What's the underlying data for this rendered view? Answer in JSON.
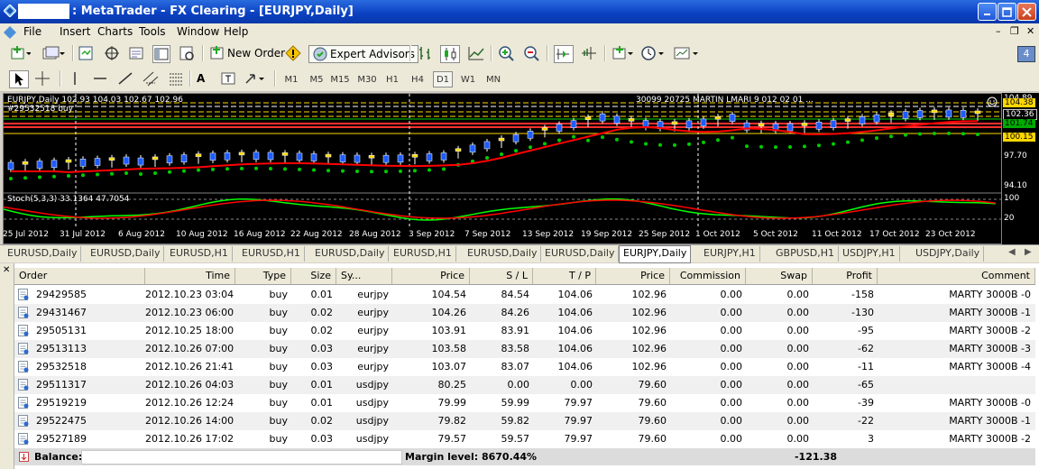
{
  "window": {
    "title": ": MetaTrader - FX Clearing - [EURJPY,Daily]"
  },
  "menu": [
    "File",
    "Insert",
    "Charts",
    "Tools",
    "Window",
    "Help"
  ],
  "toolbar": {
    "new_order": "New Order",
    "expert_advisors": "Expert Advisors",
    "timeframes": [
      "M1",
      "M5",
      "M15",
      "M30",
      "H1",
      "H4",
      "D1",
      "W1",
      "MN"
    ],
    "active_timeframe": "D1",
    "badge": "4"
  },
  "chart": {
    "header": "EURJPY,Daily  102.93 104.03 102.67 102.96",
    "order_label": "#29532518 buy",
    "ea_info": "30099 20725 MARTIN LMARI 9 012 02 01 ...",
    "stoch_label": "Stoch(5,3,3) 33.1364 47.7054",
    "price_labels": [
      "104.89",
      "102.36",
      "101.74",
      "100.15",
      "97.70",
      "94.10"
    ],
    "tags": {
      "p1": "104.38",
      "p2": "102.36",
      "p3": "101.74",
      "p4": "100.15"
    },
    "stoch_labels": [
      "100",
      "20"
    ],
    "dates": [
      "25 Jul 2012",
      "31 Jul 2012",
      "6 Aug 2012",
      "10 Aug 2012",
      "16 Aug 2012",
      "22 Aug 2012",
      "28 Aug 2012",
      "3 Sep 2012",
      "7 Sep 2012",
      "13 Sep 2012",
      "19 Sep 2012",
      "25 Sep 2012",
      "1 Oct 2012",
      "5 Oct 2012",
      "11 Oct 2012",
      "17 Oct 2012",
      "23 Oct 2012"
    ],
    "colors": {
      "bull": "#1e5cff",
      "bear": "#ffd700",
      "ma": "#ff0000",
      "sar": "#00cc00",
      "stoch_main": "#00ff00",
      "stoch_signal": "#ff0000"
    }
  },
  "chart_tabs": [
    "EURUSD,Daily",
    "EURUSD,Daily",
    "EURUSD,H1",
    "EURUSD,H1",
    "EURUSD,Daily",
    "EURUSD,H1",
    "EURUSD,Daily",
    "EURUSD,Daily",
    "EURJPY,Daily",
    "EURJPY,H1",
    "GBPUSD,H1",
    "USDJPY,H1",
    "USDJPY,Daily"
  ],
  "active_tab": 8,
  "terminal": {
    "columns": [
      "Order",
      "Time",
      "Type",
      "Size",
      "Sy...",
      "Price",
      "S / L",
      "T / P",
      "Price",
      "Commission",
      "Swap",
      "Profit",
      "Comment"
    ],
    "rows": [
      {
        "order": "29429585",
        "time": "2012.10.23 03:04",
        "type": "buy",
        "size": "0.01",
        "symbol": "eurjpy",
        "price": "104.54",
        "sl": "84.54",
        "tp": "104.06",
        "cur": "102.96",
        "comm": "0.00",
        "swap": "0.00",
        "profit": "-158",
        "comment": "MARTY 3000B -0"
      },
      {
        "order": "29431467",
        "time": "2012.10.23 06:00",
        "type": "buy",
        "size": "0.02",
        "symbol": "eurjpy",
        "price": "104.26",
        "sl": "84.26",
        "tp": "104.06",
        "cur": "102.96",
        "comm": "0.00",
        "swap": "0.00",
        "profit": "-130",
        "comment": "MARTY 3000B -1"
      },
      {
        "order": "29505131",
        "time": "2012.10.25 18:00",
        "type": "buy",
        "size": "0.02",
        "symbol": "eurjpy",
        "price": "103.91",
        "sl": "83.91",
        "tp": "104.06",
        "cur": "102.96",
        "comm": "0.00",
        "swap": "0.00",
        "profit": "-95",
        "comment": "MARTY 3000B -2"
      },
      {
        "order": "29513113",
        "time": "2012.10.26 07:00",
        "type": "buy",
        "size": "0.03",
        "symbol": "eurjpy",
        "price": "103.58",
        "sl": "83.58",
        "tp": "104.06",
        "cur": "102.96",
        "comm": "0.00",
        "swap": "0.00",
        "profit": "-62",
        "comment": "MARTY 3000B -3"
      },
      {
        "order": "29532518",
        "time": "2012.10.26 21:41",
        "type": "buy",
        "size": "0.03",
        "symbol": "eurjpy",
        "price": "103.07",
        "sl": "83.07",
        "tp": "104.06",
        "cur": "102.96",
        "comm": "0.00",
        "swap": "0.00",
        "profit": "-11",
        "comment": "MARTY 3000B -4"
      },
      {
        "order": "29511317",
        "time": "2012.10.26 04:03",
        "type": "buy",
        "size": "0.01",
        "symbol": "usdjpy",
        "price": "80.25",
        "sl": "0.00",
        "tp": "0.00",
        "cur": "79.60",
        "comm": "0.00",
        "swap": "0.00",
        "profit": "-65",
        "comment": ""
      },
      {
        "order": "29519219",
        "time": "2012.10.26 12:24",
        "type": "buy",
        "size": "0.01",
        "symbol": "usdjpy",
        "price": "79.99",
        "sl": "59.99",
        "tp": "79.97",
        "cur": "79.60",
        "comm": "0.00",
        "swap": "0.00",
        "profit": "-39",
        "comment": "MARTY 3000B -0"
      },
      {
        "order": "29522475",
        "time": "2012.10.26 14:00",
        "type": "buy",
        "size": "0.02",
        "symbol": "usdjpy",
        "price": "79.82",
        "sl": "59.82",
        "tp": "79.97",
        "cur": "79.60",
        "comm": "0.00",
        "swap": "0.00",
        "profit": "-22",
        "comment": "MARTY 3000B -1"
      },
      {
        "order": "29527189",
        "time": "2012.10.26 17:02",
        "type": "buy",
        "size": "0.03",
        "symbol": "usdjpy",
        "price": "79.57",
        "sl": "59.57",
        "tp": "79.97",
        "cur": "79.60",
        "comm": "0.00",
        "swap": "0.00",
        "profit": "3",
        "comment": "MARTY 3000B -2"
      }
    ],
    "balance_label": "Balance:",
    "margin_level": "Margin level: 8670.44%",
    "total_profit": "-121.38"
  }
}
